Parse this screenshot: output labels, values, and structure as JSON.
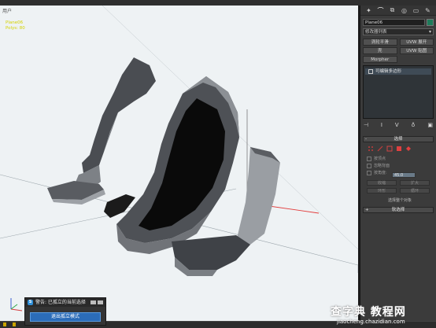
{
  "viewport": {
    "label": "用户",
    "stats": [
      "Plane06",
      "Polys: 80"
    ]
  },
  "command_panel": {
    "tabs": [
      {
        "name": "create-tab-icon",
        "glyph": "✦"
      },
      {
        "name": "modify-tab-icon",
        "glyph": "⌒"
      },
      {
        "name": "hierarchy-tab-icon",
        "glyph": "⧉"
      },
      {
        "name": "motion-tab-icon",
        "glyph": "◎"
      },
      {
        "name": "display-tab-icon",
        "glyph": "▭"
      },
      {
        "name": "utilities-tab-icon",
        "glyph": "✎"
      }
    ],
    "object_name": "Plane06",
    "object_color": "#1e7b5a",
    "modifier_list": "修改器列表",
    "modifier_list_arrow": "▾",
    "modifier_buttons": [
      "涡轮平滑",
      "UVW 展开",
      "壳",
      "UVW 贴图",
      "Morpher"
    ],
    "stack_item": "可编辑多边形",
    "stack_tools": [
      "⊣",
      "I",
      "V",
      "♁",
      "▣"
    ],
    "selection_rollout": "选择",
    "selection_icons": [
      {
        "name": "vertex-select-icon",
        "color": "#c23b3b"
      },
      {
        "name": "edge-select-icon",
        "color": "#c23b3b"
      },
      {
        "name": "border-select-icon",
        "color": "#d04545"
      },
      {
        "name": "polygon-select-icon",
        "color": "#e04040"
      },
      {
        "name": "element-select-icon",
        "color": "#e04040"
      }
    ],
    "selection_options": [
      "按顶点",
      "忽略背面",
      "按角度:"
    ],
    "angle_value": "45.0",
    "shrink_label": "收缩",
    "grow_label": "扩大",
    "ring_label": "环形",
    "loop_label": "循环",
    "selection_status": "选择整个对象",
    "soft_selection_rollout": "软选择",
    "rollout_sign": "+",
    "rollout_sign_open": "-"
  },
  "dialog": {
    "icon_letter": "S",
    "message": "警告: 已孤立的当前选择",
    "exit_button": "退出孤立模式"
  },
  "watermark": {
    "title": "查字典 教程网",
    "url": "jiaocheng.chazidian.com"
  },
  "colors": {
    "viewport_bg": "#eef2f4",
    "seat_dark": "#111111",
    "seat_mid": "#5a5d62",
    "seat_light": "#8f9398",
    "selection_blue": "#2b6cb8"
  }
}
